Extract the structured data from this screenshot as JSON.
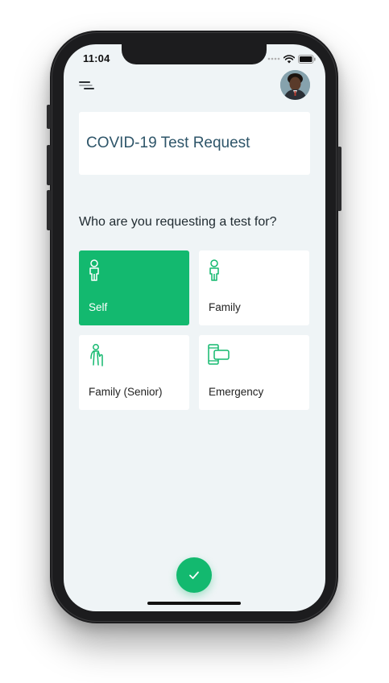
{
  "status_bar": {
    "time": "11:04",
    "icons": [
      "signal-dots-icon",
      "wifi-icon",
      "battery-icon"
    ]
  },
  "header": {
    "menu_icon": "menu-icon",
    "avatar": "user-avatar"
  },
  "title_card": {
    "title": "COVID-19 Test Request"
  },
  "question": "Who are you requesting a test for?",
  "options": [
    {
      "label": "Self",
      "icon": "person-icon",
      "selected": true
    },
    {
      "label": "Family",
      "icon": "person-icon",
      "selected": false
    },
    {
      "label": "Family (Senior)",
      "icon": "senior-person-icon",
      "selected": false
    },
    {
      "label": "Emergency",
      "icon": "phone-call-icon",
      "selected": false
    }
  ],
  "fab": {
    "icon": "checkmark-icon"
  },
  "colors": {
    "accent": "#13b96f",
    "screen_bg": "#eff4f6",
    "title_text": "#2e5569",
    "body_text": "#1f2a30"
  }
}
